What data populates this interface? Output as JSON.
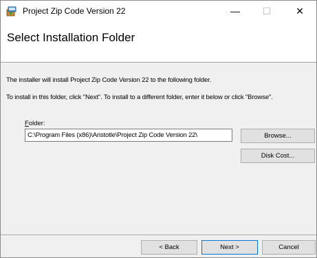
{
  "window": {
    "title": "Project Zip Code Version 22",
    "controls": {
      "minimize": "—",
      "maximize": "☐",
      "close": "✕"
    }
  },
  "header": {
    "title": "Select Installation Folder"
  },
  "body": {
    "line1": "The installer will install Project Zip Code Version 22 to the following folder.",
    "line2": "To install in this folder, click \"Next\". To install to a different folder, enter it below or click \"Browse\"."
  },
  "folder": {
    "label_prefix": "F",
    "label_rest": "older:",
    "value": "C:\\Program Files (x86)\\Aristotle\\Project Zip Code Version 22\\"
  },
  "buttons": {
    "browse": "Browse...",
    "disk_cost": "Disk Cost...",
    "back": "< Back",
    "next": "Next >",
    "cancel": "Cancel"
  },
  "icons": {
    "app": "installer-package-icon"
  },
  "colors": {
    "accent": "#0078d7",
    "window_bg": "#f0f0f0",
    "header_bg": "#ffffff"
  }
}
